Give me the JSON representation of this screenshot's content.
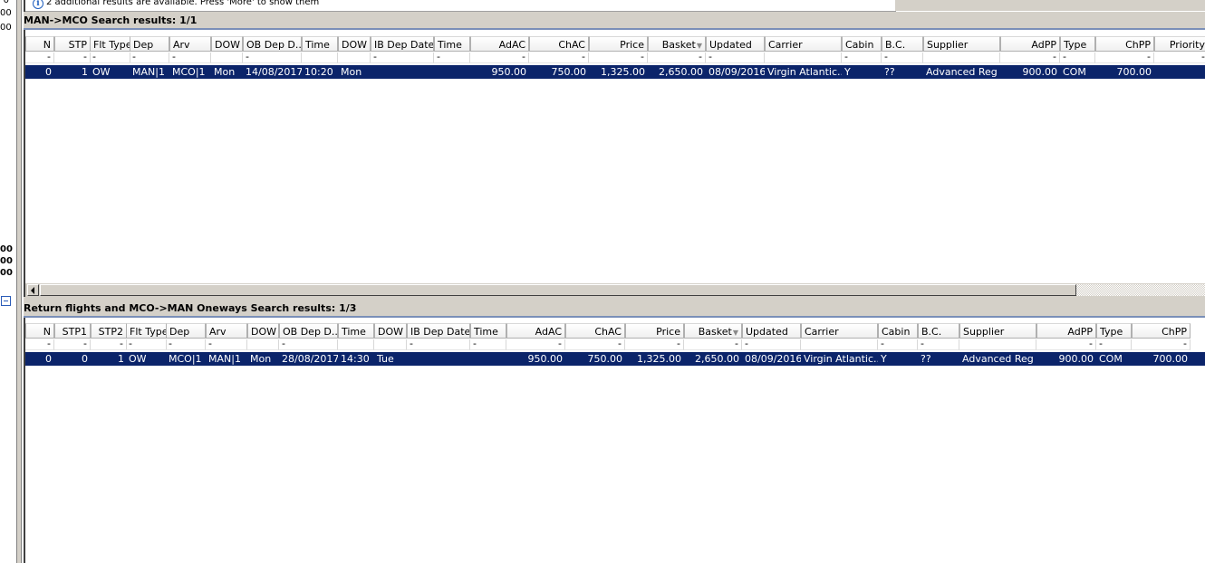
{
  "left_strip": {
    "top_values": [
      "0",
      "00",
      "00"
    ],
    "bottom_values": [
      "00",
      "00",
      "00"
    ]
  },
  "info_bar": {
    "icon": "info-icon",
    "text": "2 additional results are available. Press 'More' to show them"
  },
  "outbound": {
    "title": "MAN->MCO Search results: 1/1",
    "columns": [
      "N",
      "STP",
      "Flt Type",
      "Dep",
      "Arv",
      "DOW",
      "OB Dep D...",
      "Time",
      "DOW",
      "IB Dep Date",
      "Time",
      "AdAC",
      "ChAC",
      "Price",
      "Basket",
      "Updated",
      "Carrier",
      "Cabin",
      "B.C.",
      "Supplier",
      "AdPP",
      "Type",
      "ChPP",
      "Priority"
    ],
    "filters": [
      "-",
      "-",
      "-",
      "-",
      "-",
      "",
      "-",
      "",
      "",
      "-",
      "-",
      "-",
      "-",
      "-",
      "-",
      "-",
      "",
      "-",
      "-",
      "",
      "-",
      "-",
      "-",
      "-"
    ],
    "rows": [
      [
        "0",
        "1",
        "OW",
        "MAN|1",
        "MCO|1",
        "Mon",
        "14/08/2017",
        "10:20",
        "Mon",
        "",
        "",
        "950.00",
        "750.00",
        "1,325.00",
        "2,650.00",
        "08/09/2016",
        "Virgin Atlantic...",
        "Y",
        "??",
        "Advanced Reg",
        "900.00",
        "COM",
        "700.00",
        ""
      ]
    ]
  },
  "return": {
    "title": "Return flights and MCO->MAN Oneways Search results: 1/3",
    "columns": [
      "N",
      "STP1",
      "STP2",
      "Flt Type",
      "Dep",
      "Arv",
      "DOW",
      "OB Dep D...",
      "Time",
      "DOW",
      "IB Dep Date",
      "Time",
      "AdAC",
      "ChAC",
      "Price",
      "Basket",
      "Updated",
      "Carrier",
      "Cabin",
      "B.C.",
      "Supplier",
      "AdPP",
      "Type",
      "ChPP"
    ],
    "filters": [
      "-",
      "-",
      "-",
      "-",
      "-",
      "-",
      "",
      "-",
      "",
      "",
      "-",
      "-",
      "-",
      "-",
      "-",
      "-",
      "-",
      "",
      "-",
      "-",
      "",
      "-",
      "-",
      "-"
    ],
    "rows": [
      [
        "0",
        "0",
        "1",
        "OW",
        "MCO|1",
        "MAN|1",
        "Mon",
        "28/08/2017",
        "14:30",
        "Tue",
        "",
        "",
        "950.00",
        "750.00",
        "1,325.00",
        "2,650.00",
        "08/09/2016",
        "Virgin Atlantic...",
        "Y",
        "??",
        "Advanced Reg",
        "900.00",
        "COM",
        "700.00"
      ]
    ]
  }
}
